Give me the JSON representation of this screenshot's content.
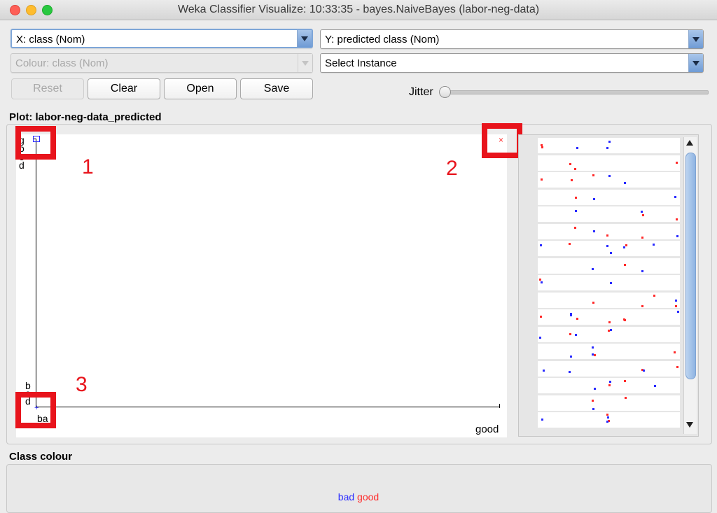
{
  "window": {
    "title": "Weka Classifier Visualize: 10:33:35 - bayes.NaiveBayes (labor-neg-data)",
    "traffic_lights": [
      "close",
      "minimize",
      "zoom"
    ]
  },
  "controls": {
    "x_axis": "X: class (Nom)",
    "y_axis": "Y: predicted class (Nom)",
    "colour": "Colour: class (Nom)",
    "select_instance": "Select Instance",
    "reset": "Reset",
    "clear": "Clear",
    "open": "Open",
    "save": "Save",
    "jitter_label": "Jitter",
    "jitter_value": 0
  },
  "plot": {
    "title": "Plot: labor-neg-data_predicted",
    "y_top_label_chars": [
      "g",
      "o",
      "o",
      "d"
    ],
    "y_bottom_label_chars": [
      "b",
      "a",
      "d"
    ],
    "x_left_label": "ba",
    "x_right_label": "good",
    "annotations": [
      "1",
      "2",
      "3"
    ]
  },
  "class_colour": {
    "title": "Class colour",
    "legend": [
      {
        "label": "bad",
        "color": "#2a2cff"
      },
      {
        "label": "good",
        "color": "#ff2a2a"
      }
    ]
  },
  "colors": {
    "bad": "#2a2cff",
    "good": "#ff2a2a",
    "highlight": "#e8141c"
  }
}
